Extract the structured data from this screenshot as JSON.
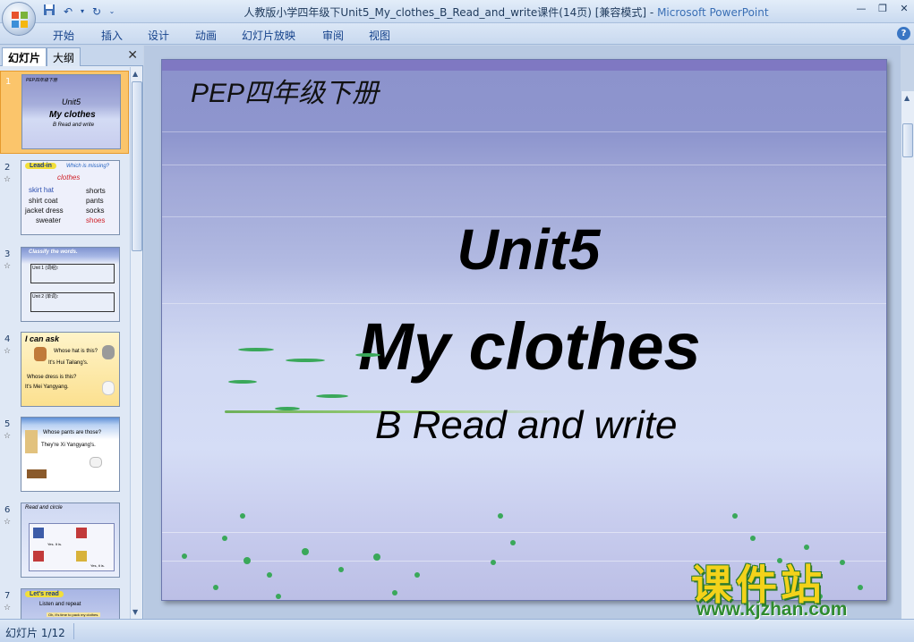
{
  "window": {
    "title": "人教版小学四年级下Unit5_My_clothes_B_Read_and_write课件(14页) [兼容模式] - ",
    "app_name": "Microsoft PowerPoint",
    "quick_access": [
      "save-icon",
      "undo-icon",
      "dropdown-icon",
      "redo-icon",
      "customize-icon"
    ]
  },
  "menu": {
    "items": [
      "开始",
      "插入",
      "设计",
      "动画",
      "幻灯片放映",
      "审阅",
      "视图"
    ],
    "help": "?"
  },
  "left_pane": {
    "tabs": [
      "幻灯片",
      "大纲"
    ],
    "close": "✕",
    "thumbnails": [
      {
        "num": "1",
        "lines": [
          "Unit5",
          "My clothes",
          "B  Read and write"
        ],
        "header": "PEP四年级下册"
      },
      {
        "num": "2",
        "header": "Lead-in",
        "header_right": "Which is missing?",
        "lines": [
          "clothes",
          "skirt  hat",
          "shorts",
          "shirt  coat",
          "pants",
          "jacket dress",
          "socks",
          "sweater",
          "shoes"
        ]
      },
      {
        "num": "3",
        "header": "Classify the words.",
        "lines": [
          "Unit 1 (词组):",
          "Unit 2 (单词):"
        ]
      },
      {
        "num": "4",
        "header": "I can ask",
        "lines": [
          "Whose hat is this?",
          "It's Hui Tailang's.",
          "Whose dress is this?",
          "It's Mei Yangyang."
        ]
      },
      {
        "num": "5",
        "lines": [
          "Whose pants are those?",
          "They're Xi Yangyang's."
        ]
      },
      {
        "num": "6",
        "header": "Read and circle",
        "lines": [
          "Yes. It is.",
          "Yes, it is."
        ]
      },
      {
        "num": "7",
        "header": "Let's read",
        "lines": [
          "Listen and repeat",
          "Oh, it's time to pack my clothes."
        ]
      }
    ]
  },
  "slide": {
    "header": "PEP四年级下册",
    "unit": "Unit5",
    "title": "My clothes",
    "subtitle": "B  Read and write"
  },
  "status": {
    "slide_count": "幻灯片 1/12"
  },
  "watermark": {
    "cn": "课件站",
    "url": "www.kjzhan.com"
  }
}
